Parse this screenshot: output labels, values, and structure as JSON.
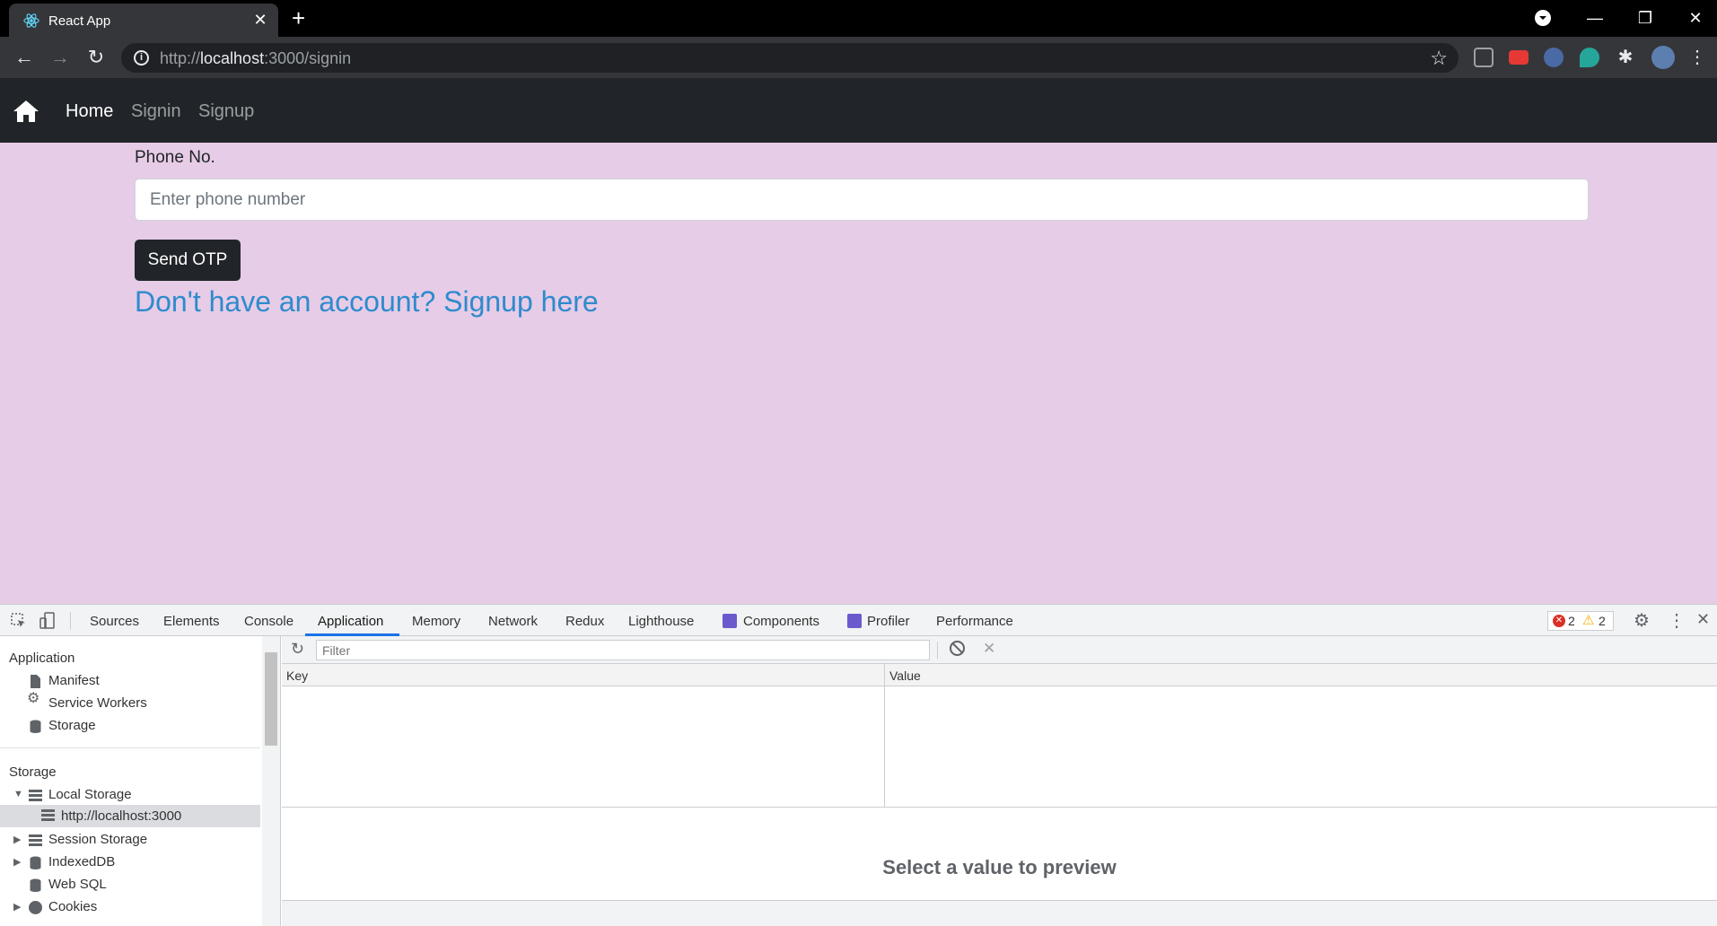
{
  "browser": {
    "tab_title": "React App",
    "url_host": "localhost",
    "url_prefix": "http://",
    "url_rest": ":3000/signin",
    "new_tab": "+",
    "close_tab": "✕",
    "minimize": "—",
    "restore": "❐",
    "close_window": "✕"
  },
  "navbar": {
    "home_label": "Home",
    "signin_label": "Signin",
    "signup_label": "Signup"
  },
  "form": {
    "phone_label": "Phone No.",
    "phone_placeholder": "Enter phone number",
    "send_otp_label": "Send OTP",
    "signup_link": "Don't have an account? Signup here"
  },
  "colors": {
    "page_background": "#e6cce6",
    "navbar": "#212529",
    "link": "#2e8bce"
  },
  "devtools": {
    "tabs": [
      "Sources",
      "Elements",
      "Console",
      "Application",
      "Memory",
      "Network",
      "Redux",
      "Lighthouse",
      "Components",
      "Profiler",
      "Performance"
    ],
    "active_tab": "Application",
    "errors": "2",
    "warnings": "2",
    "sidebar": {
      "application_heading": "Application",
      "application_items": [
        "Manifest",
        "Service Workers",
        "Storage"
      ],
      "storage_heading": "Storage",
      "storage_items": [
        "Local Storage",
        "http://localhost:3000",
        "Session Storage",
        "IndexedDB",
        "Web SQL",
        "Cookies"
      ]
    },
    "filter_placeholder": "Filter",
    "columns": [
      "Key",
      "Value"
    ],
    "preview_text": "Select a value to preview"
  }
}
